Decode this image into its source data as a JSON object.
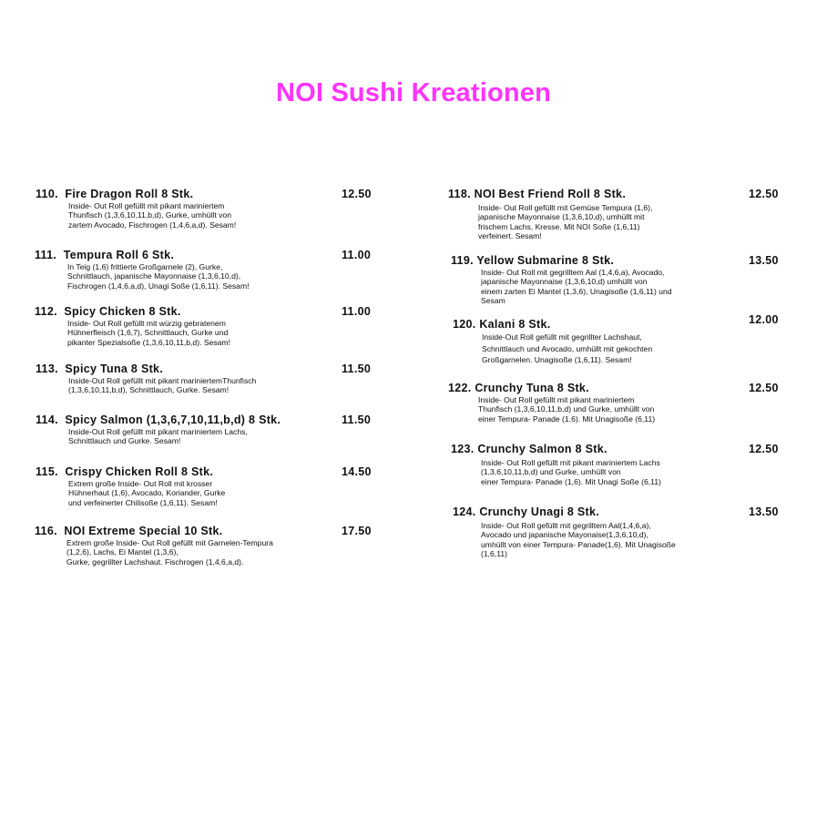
{
  "title": "NOI Sushi Kreationen",
  "colors": {
    "title": "#ff33ff",
    "text": "#111111",
    "background": "#ffffff"
  },
  "left_column": [
    {
      "number": "110.",
      "name": "Fire Dragon Roll 8 Stk.",
      "price": "12.50",
      "description": "Inside- Out Roll gefüllt mit pikant mariniertem\nThunfisch (1,3,6,10,11,b,d), Gurke, umhüllt von\nzartem Avocado, Fischrogen (1,4,6,a,d). Sesam!"
    },
    {
      "number": "111.",
      "name": "Tempura Roll 6 Stk.",
      "price": "11.00",
      "description": "In Teig (1,6) frittierte Großgarnele (2), Gurke,\nSchnittlauch, japanische Mayonnaise (1,3,6,10,d),\nFischrogen (1,4,6,a,d), Unagi Soße (1,6,11). Sesam!"
    },
    {
      "number": "112.",
      "name": "Spicy Chicken 8 Stk.",
      "price": "11.00",
      "description": "Inside- Out Roll gefüllt mit würzig gebratenem\nHühnerfleisch (1,6,7), Schnittlauch, Gurke und\npikanter Spezialsoße (1,3,6,10,11,b,d). Sesam!"
    },
    {
      "number": "113.",
      "name": "Spicy Tuna 8 Stk.",
      "price": "11.50",
      "description": "Inside-Out Roll gefüllt mit pikant mariniertemThunfisch\n(1,3,6,10,11,b,d), Schnittlauch, Gurke. Sesam!"
    },
    {
      "number": "114.",
      "name": "Spicy Salmon (1,3,6,7,10,11,b,d) 8 Stk.",
      "price": "11.50",
      "description": "Inside-Out Roll gefüllt mit pikant mariniertem Lachs,\nSchnittlauch und Gurke. Sesam!"
    },
    {
      "number": "115.",
      "name": "Crispy Chicken Roll 8 Stk.",
      "price": "14.50",
      "description": "Extrem große Inside- Out Roll mit krosser\nHühnerhaut (1,6), Avocado, Koriander, Gurke\nund verfeinerter Chilisoße (1,6,11). Sesam!"
    },
    {
      "number": "116.",
      "name": "NOI Extreme Special 10 Stk.",
      "price": "17.50",
      "description": "Extrem große Inside- Out Roll gefüllt mit Garnelen-Tempura\n(1,2,6), Lachs, Ei Mantel (1,3,6),\nGurke, gegrillter Lachshaut. Fischrogen (1,4,6,a,d)."
    }
  ],
  "right_column": [
    {
      "number": "118.",
      "name": "NOI Best Friend Roll 8 Stk.",
      "price": "12.50",
      "description": "Inside- Out Roll gefüllt mit Gemüse Tempura (1,6),\njapanische Mayonnaise (1,3,6,10,d), umhüllt mit\nfrischem Lachs,  Kresse. Mit NOI Soße (1,6,11)\nverfeinert. Sesam!"
    },
    {
      "number": "119.",
      "name": "Yellow Submarine 8 Stk.",
      "price": "13.50",
      "description": "Inside- Out Roll mit gegrilltem Aal (1,4,6,a), Avocado,\njapanische Mayonnaise (1,3,6,10,d) umhüllt von\neinem zarten Ei Mantel (1,3,6), Unagisoße (1,6,11) und\nSesam"
    },
    {
      "number": "120.",
      "name": "Kalani 8 Stk.",
      "price": "12.00",
      "description": "Inside-Out Roll gefüllt mit gegrillter Lachshaut,\nSchnittlauch und Avocado, umhüllt mit gekochten\nGroßgarnelen. Unagisoße (1,6,11). Sesam!"
    },
    {
      "number": "122.",
      "name": "Crunchy Tuna 8 Stk.",
      "price": "12.50",
      "description": "Inside- Out Roll gefüllt mit pikant mariniertem\nThunfisch (1,3,6,10,11,b,d) und Gurke, umhüllt von\neiner Tempura- Panade (1,6). Mit Unagisoße (6,11)"
    },
    {
      "number": "123.",
      "name": "Crunchy Salmon 8 Stk.",
      "price": "12.50",
      "description": "Inside- Out Roll gefüllt mit pikant mariniertem Lachs\n(1,3,6,10,11,b,d) und Gurke, umhüllt von\neiner Tempura- Panade (1,6). Mit Unagi Soße (6,11)"
    },
    {
      "number": "124.",
      "name": "Crunchy Unagi 8 Stk.",
      "price": "13.50",
      "description": "Inside- Out Roll gefüllt mit gegrilltem Aal(1,4,6,a),\nAvocado und japanische Mayonaise(1,3,6,10,d),\numhüllt von einer Tempura- Panade(1,6). Mit Unagisoße\n(1,6,11)"
    }
  ]
}
